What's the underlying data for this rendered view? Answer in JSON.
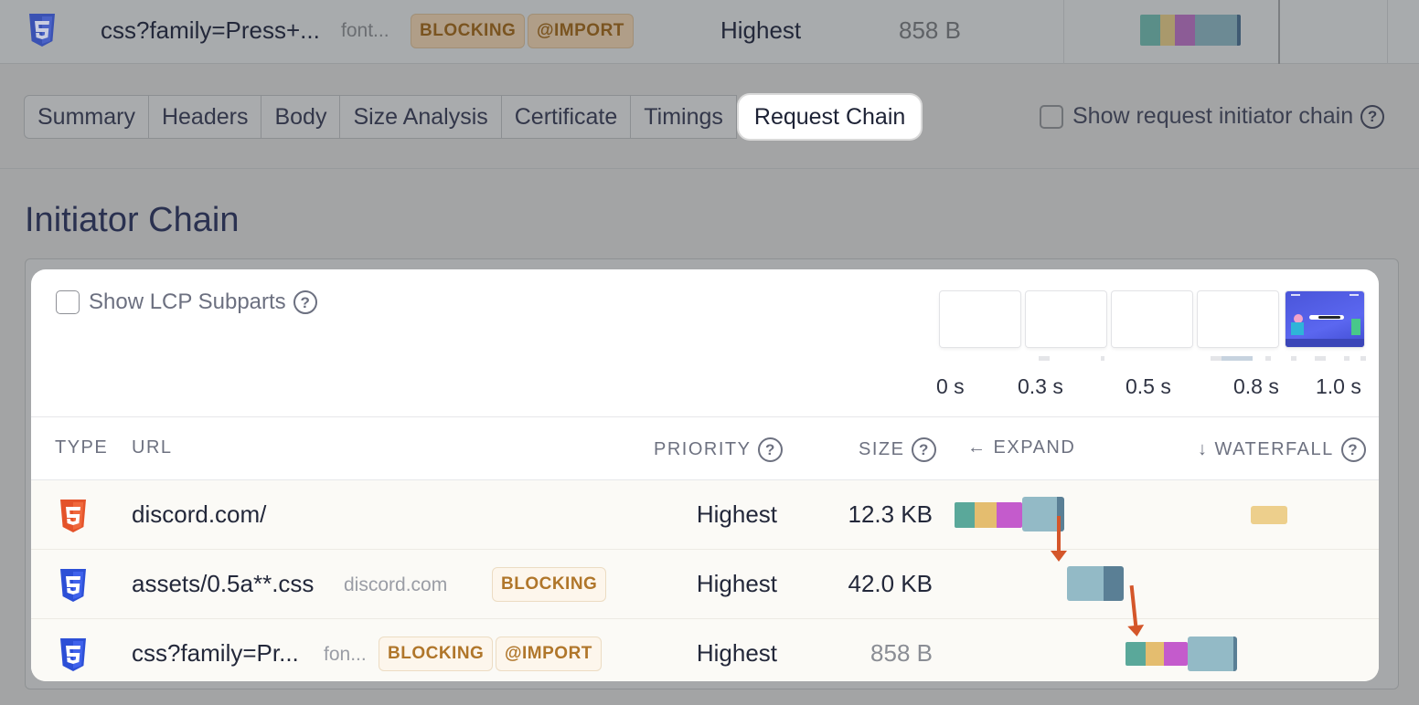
{
  "top_request": {
    "url": "css?family=Press+...",
    "host": "font...",
    "badges": [
      "BLOCKING",
      "@IMPORT"
    ],
    "priority": "Highest",
    "size": "858 B"
  },
  "tabs": [
    {
      "label": "Summary"
    },
    {
      "label": "Headers"
    },
    {
      "label": "Body"
    },
    {
      "label": "Size Analysis"
    },
    {
      "label": "Certificate"
    },
    {
      "label": "Timings"
    },
    {
      "label": "Request Chain",
      "active": true
    }
  ],
  "show_initiator_chain": {
    "label": "Show request initiator chain",
    "checked": false
  },
  "section_title": "Initiator Chain",
  "lcp_toggle": {
    "label": "Show LCP Subparts",
    "checked": false
  },
  "timeline": {
    "labels": [
      "0 s",
      "0.3 s",
      "0.5 s",
      "0.8 s",
      "1.0 s"
    ]
  },
  "table": {
    "headers": {
      "type": "TYPE",
      "url": "URL",
      "priority": "PRIORITY",
      "size": "SIZE",
      "expand": "← EXPAND",
      "waterfall": "↓ WATERFALL"
    },
    "rows": [
      {
        "type_icon": "html5-icon",
        "url": "discord.com/",
        "host": "",
        "badges": [],
        "priority": "Highest",
        "size": "12.3 KB"
      },
      {
        "type_icon": "css3-icon",
        "url": "assets/0.5a**.css",
        "host": "discord.com",
        "badges": [
          "BLOCKING"
        ],
        "priority": "Highest",
        "size": "42.0 KB"
      },
      {
        "type_icon": "css3-icon",
        "url": "css?family=Pr...",
        "host": "fon...",
        "badges": [
          "BLOCKING",
          "@IMPORT"
        ],
        "priority": "Highest",
        "size": "858 B"
      }
    ]
  },
  "colors": {
    "dns": "#5aa89a",
    "connect": "#e4bd6f",
    "ssl": "#c45bcc",
    "download": "#93bac6",
    "download_end": "#5a7f95",
    "arrow": "#d4562a",
    "html_icon": "#e4532a",
    "css_icon": "#2c4fd6"
  }
}
